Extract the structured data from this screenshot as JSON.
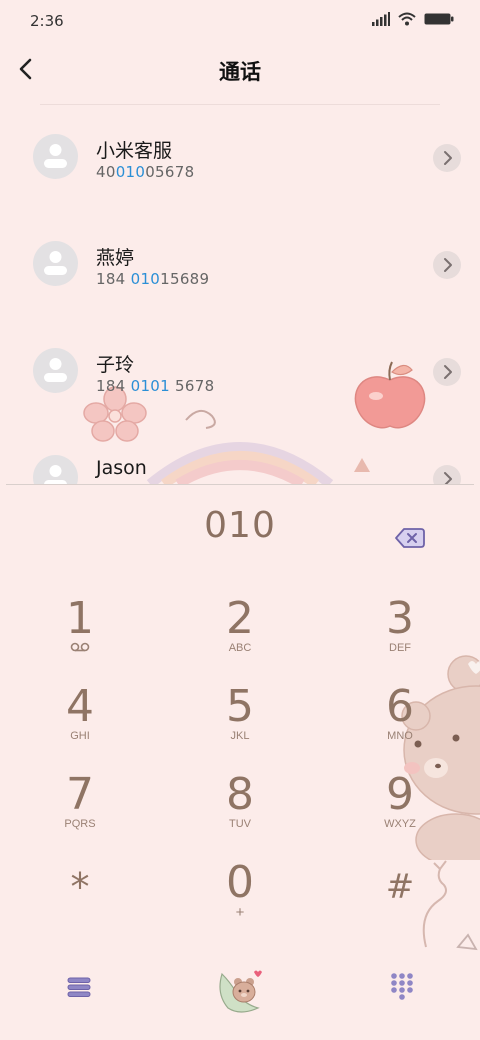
{
  "status_bar": {
    "time": "2:36"
  },
  "header": {
    "title": "通话"
  },
  "contacts": [
    {
      "name": "小米客服",
      "number_pre": "40",
      "number_hl": "010",
      "number_post": "05678"
    },
    {
      "name": "燕婷",
      "number_pre": "184 ",
      "number_hl": "010",
      "number_post": "15689"
    },
    {
      "name": "子玲",
      "number_pre": "184 ",
      "number_hl": "0101",
      "number_post": " 5678"
    },
    {
      "name": "Jason",
      "number_pre": "",
      "number_hl": "",
      "number_post": ""
    }
  ],
  "dialer": {
    "input": "010",
    "keys": [
      {
        "digit": "1",
        "letters": ""
      },
      {
        "digit": "2",
        "letters": "ABC"
      },
      {
        "digit": "3",
        "letters": "DEF"
      },
      {
        "digit": "4",
        "letters": "GHI"
      },
      {
        "digit": "5",
        "letters": "JKL"
      },
      {
        "digit": "6",
        "letters": "MNO"
      },
      {
        "digit": "7",
        "letters": "PQRS"
      },
      {
        "digit": "8",
        "letters": "TUV"
      },
      {
        "digit": "9",
        "letters": "WXYZ"
      },
      {
        "digit": "*",
        "letters": ""
      },
      {
        "digit": "0",
        "letters": "+"
      },
      {
        "digit": "#",
        "letters": ""
      }
    ]
  },
  "colors": {
    "background": "#fcecea",
    "highlight": "#2b8fd6",
    "key_text": "#8f7464"
  },
  "icons": {
    "back": "chevron-left-icon",
    "detail": "chevron-right-icon",
    "backspace": "backspace-icon",
    "voicemail": "voicemail-icon",
    "menu": "menu-icon",
    "call": "bear-call-icon",
    "dialpad": "dialpad-icon"
  }
}
